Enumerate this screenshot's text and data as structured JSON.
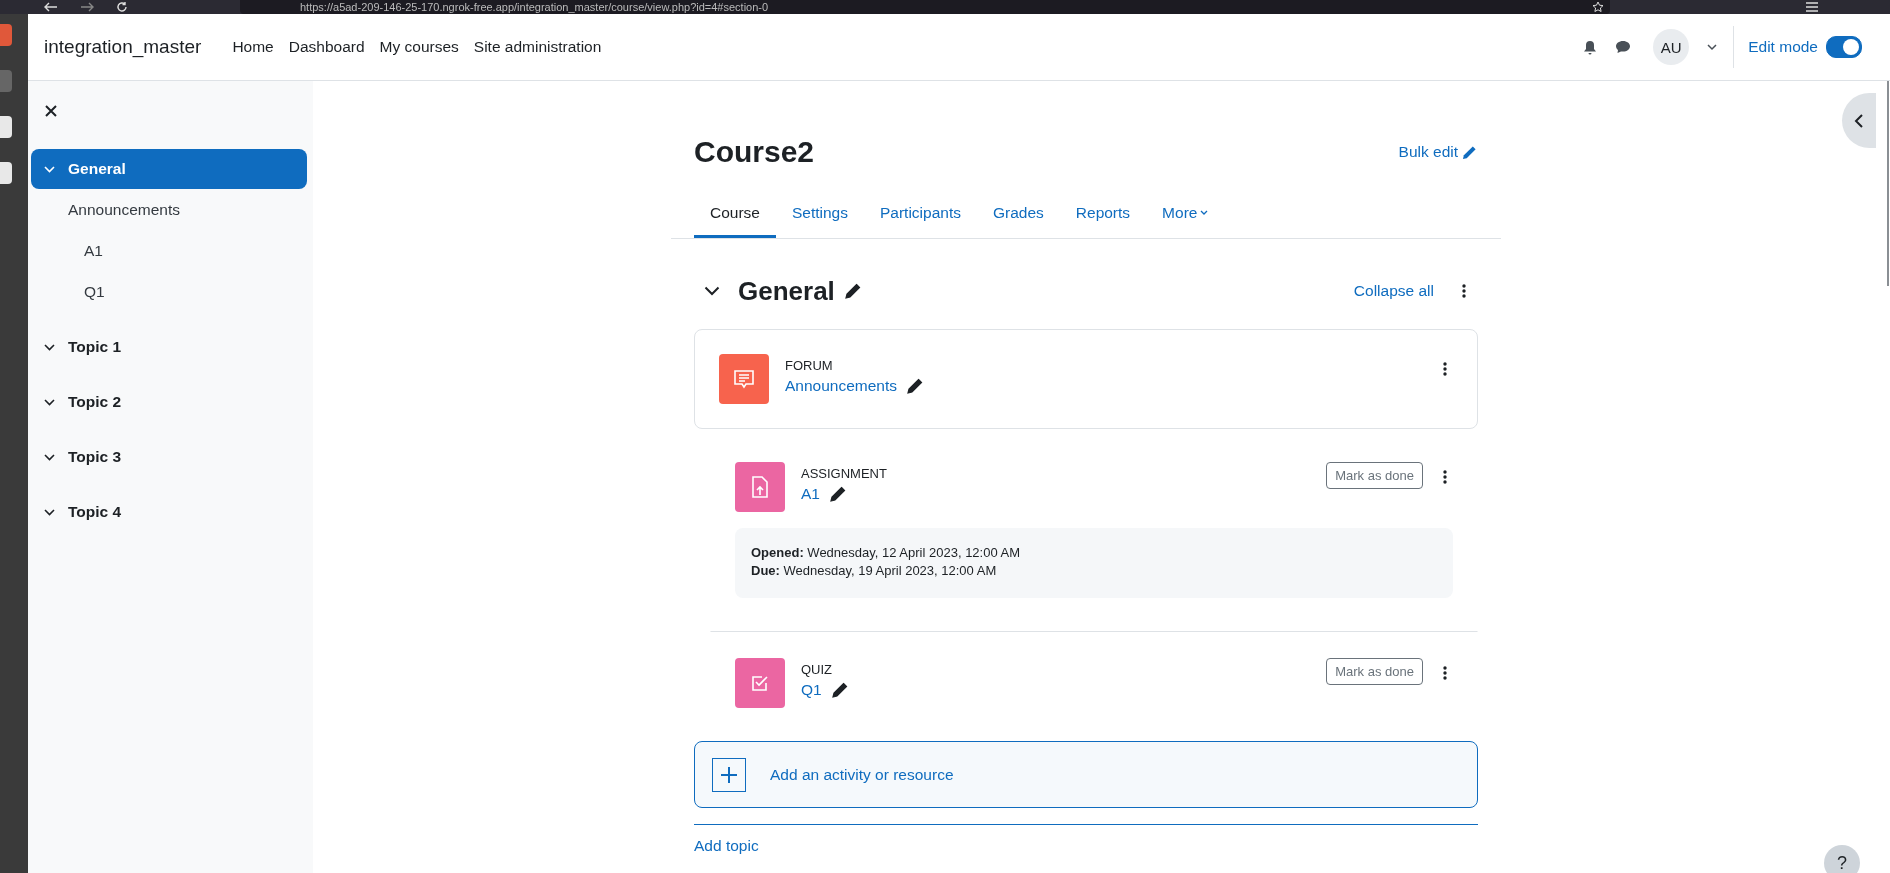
{
  "browser": {
    "url": "https://a5ad-209-146-25-170.ngrok-free.app/integration_master/course/view.php?id=4#section-0"
  },
  "navbar": {
    "brand": "integration_master",
    "links": [
      {
        "label": "Home"
      },
      {
        "label": "Dashboard"
      },
      {
        "label": "My courses"
      },
      {
        "label": "Site administration"
      }
    ],
    "user_initials": "AU",
    "edit_mode": {
      "label": "Edit mode",
      "on": true
    }
  },
  "sidebar": {
    "items": [
      {
        "label": "General",
        "selected": true,
        "expanded": true,
        "children": [
          {
            "label": "Announcements",
            "children": [
              {
                "label": "A1"
              },
              {
                "label": "Q1"
              }
            ]
          }
        ]
      },
      {
        "label": "Topic 1",
        "selected": false,
        "expanded": true
      },
      {
        "label": "Topic 2",
        "selected": false,
        "expanded": true
      },
      {
        "label": "Topic 3",
        "selected": false,
        "expanded": true
      },
      {
        "label": "Topic 4",
        "selected": false,
        "expanded": true
      }
    ]
  },
  "course": {
    "title": "Course2",
    "bulk_edit": "Bulk edit",
    "tabs": [
      {
        "label": "Course",
        "selected": true,
        "has_menu": false
      },
      {
        "label": "Settings",
        "selected": false,
        "has_menu": false
      },
      {
        "label": "Participants",
        "selected": false,
        "has_menu": false
      },
      {
        "label": "Grades",
        "selected": false,
        "has_menu": false
      },
      {
        "label": "Reports",
        "selected": false,
        "has_menu": false
      },
      {
        "label": "More",
        "selected": false,
        "has_menu": true
      }
    ]
  },
  "section": {
    "title": "General",
    "expanded": true,
    "collapse_all": "Collapse all",
    "activities": [
      {
        "kind": "forum",
        "color": "#f7634d",
        "type_label": "FORUM",
        "name": "Announcements",
        "indented": false,
        "highlighted": true
      },
      {
        "kind": "assignment",
        "color": "#eb66a2",
        "type_label": "ASSIGNMENT",
        "name": "A1",
        "indented": true,
        "highlighted": false,
        "completion_button": "Mark as done",
        "dates": [
          "**Opened:** Wednesday, 12 April 2023, 12:00 AM",
          "**Due:** Wednesday, 19 April 2023, 12:00 AM"
        ]
      },
      {
        "kind": "quiz",
        "color": "#eb66a2",
        "type_label": "QUIZ",
        "name": "Q1",
        "indented": true,
        "highlighted": false,
        "completion_button": "Mark as done"
      }
    ],
    "add_activity": "Add an activity or resource"
  },
  "add_topic": "Add topic",
  "help_button": "?"
}
